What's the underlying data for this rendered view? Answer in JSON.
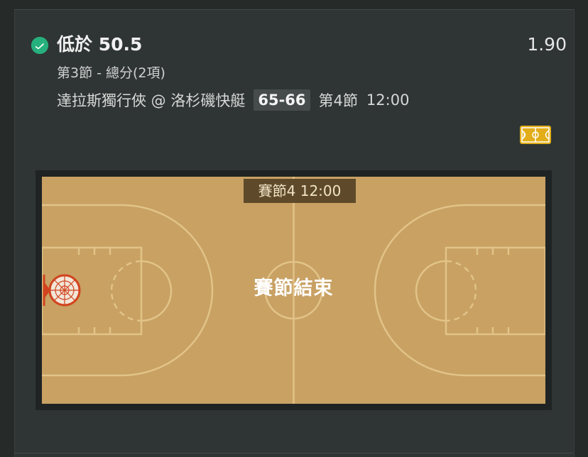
{
  "bet": {
    "status_icon": "check-circle-icon",
    "status_color": "#26b07d",
    "selection": "低於 50.5",
    "odds": "1.90",
    "market": "第3節 - 總分(2項)"
  },
  "match": {
    "teams": "達拉斯獨行俠 @ 洛杉磯快艇",
    "score": "65-66",
    "period": "第4節",
    "time": "12:00"
  },
  "court_toggle": {
    "icon": "basketball-court-icon",
    "color": "#e2ad18"
  },
  "court": {
    "clock": "賽節4  12:00",
    "status": "賽節結束",
    "court_color": "#c8a163",
    "hoop_color": "#d1441e"
  }
}
